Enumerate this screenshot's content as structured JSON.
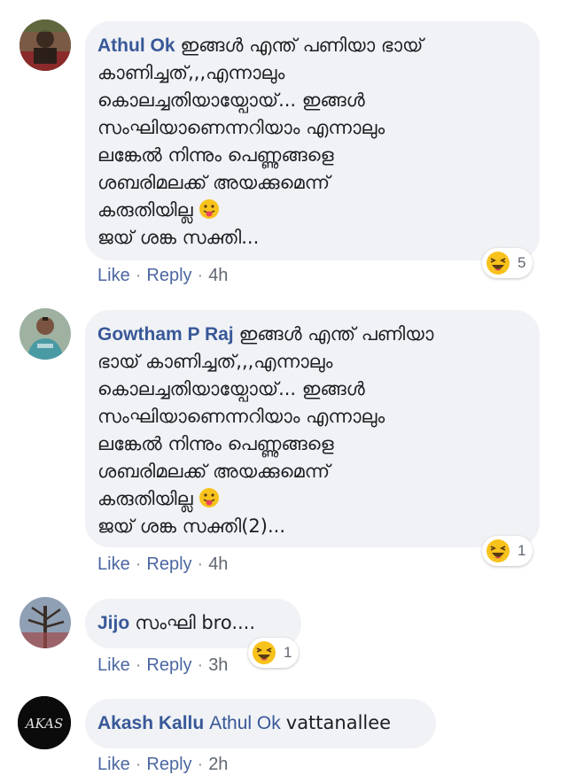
{
  "comments": [
    {
      "author": "Athul Ok",
      "mention": "",
      "lines": [
        "ഇങ്ങൾ എന്ത് പണിയാ ഭായ്",
        "കാണിച്ചത്,,,എന്നാലും",
        "കൊലച്ചതിയായ്പോയ്... ഇങ്ങൾ",
        "സംഘിയാണെന്നറിയാം എന്നാലും",
        "ലങ്കേൽ നിന്നും പെണ്ണുങ്ങളെ",
        "ശബരിമലക്ക് അയക്കുമെന്ന്",
        "കരുതിയില്ല",
        "ജയ് ശങ്ക സക്തി..."
      ],
      "like": "Like",
      "reply": "Reply",
      "time": "4h",
      "reaction_count": "5",
      "reaction_icon": "laughing-emoji"
    },
    {
      "author": "Gowtham P Raj",
      "mention": "",
      "lines": [
        "ഇങ്ങൾ എന്ത് പണിയാ",
        "ഭായ് കാണിച്ചത്,,,എന്നാലും",
        "കൊലച്ചതിയായ്പോയ്... ഇങ്ങൾ",
        "സംഘിയാണെന്നറിയാം എന്നാലും",
        "ലങ്കേൽ നിന്നും പെണ്ണുങ്ങളെ",
        "ശബരിമലക്ക് അയക്കുമെന്ന്",
        "കരുതിയില്ല",
        "ജയ് ശങ്ക സക്തി(2)..."
      ],
      "like": "Like",
      "reply": "Reply",
      "time": "4h",
      "reaction_count": "1",
      "reaction_icon": "laughing-emoji"
    },
    {
      "author": "Jijo",
      "mention": "",
      "lines": [
        "സംഘി bro...."
      ],
      "like": "Like",
      "reply": "Reply",
      "time": "3h",
      "reaction_count": "1",
      "reaction_icon": "laughing-emoji"
    },
    {
      "author": "Akash Kallu",
      "mention": "Athul Ok",
      "lines": [
        "vattanallee"
      ],
      "like": "Like",
      "reply": "Reply",
      "time": "2h"
    }
  ],
  "colors": {
    "bubble": "#f0f2f5",
    "author": "#385898",
    "action_link": "#4b67a1"
  }
}
